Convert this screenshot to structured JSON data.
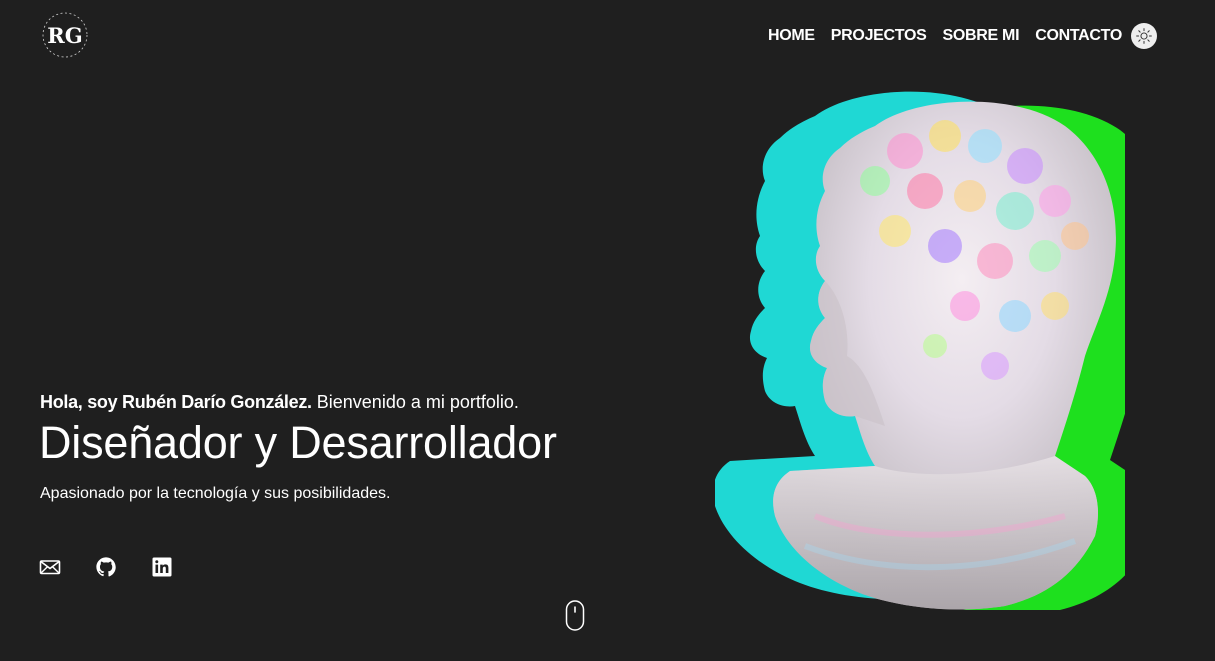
{
  "header": {
    "logo_text": "RG",
    "nav": [
      {
        "label": "HOME"
      },
      {
        "label": "PROJECTOS"
      },
      {
        "label": "SOBRE MI"
      },
      {
        "label": "CONTACTO"
      }
    ],
    "theme_toggle_icon": "sun-icon"
  },
  "hero": {
    "greeting_bold": "Hola, soy Rubén Darío González.",
    "greeting_rest": "Bienvenido a mi portfolio.",
    "headline": "Diseñador y Desarrollador",
    "tagline": "Apasionado por la tecnología y sus posibilidades.",
    "socials": [
      {
        "icon": "mail-icon"
      },
      {
        "icon": "github-icon"
      },
      {
        "icon": "linkedin-icon"
      }
    ],
    "scroll_icon": "mouse-scroll-icon"
  },
  "artwork": {
    "subject": "bust-image",
    "colors": {
      "cyan": "#1fd8d4",
      "green": "#1ee01e",
      "main": "#e8e0e4",
      "background": "#1f1f1f"
    }
  }
}
